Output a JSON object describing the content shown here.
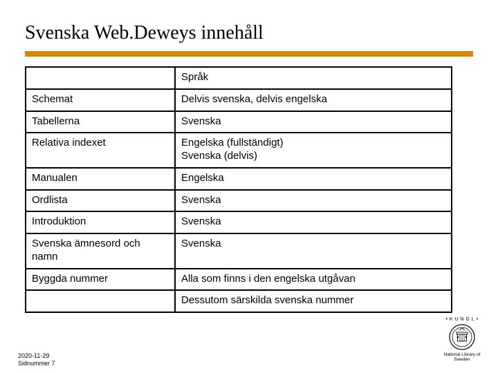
{
  "title": "Svenska Web.Deweys innehåll",
  "table": {
    "header": {
      "col1": "",
      "col2": "Språk"
    },
    "rows": [
      {
        "col1": "Schemat",
        "col2": "Delvis svenska, delvis engelska"
      },
      {
        "col1": "Tabellerna",
        "col2": "Svenska"
      },
      {
        "col1": "Relativa indexet",
        "col2": "Engelska (fullständigt)\nSvenska (delvis)"
      },
      {
        "col1": "Manualen",
        "col2": "Engelska"
      },
      {
        "col1": "Ordlista",
        "col2": "Svenska"
      },
      {
        "col1": "Introduktion",
        "col2": "Svenska"
      },
      {
        "col1": "Svenska ämnesord och namn",
        "col2": "Svenska"
      },
      {
        "col1": "Byggda nummer",
        "col2": "Alla som finns i den engelska utgåvan"
      },
      {
        "col1": "",
        "col2": "Dessutom särskilda svenska nummer"
      }
    ]
  },
  "footer": {
    "date": "2020-11-29",
    "page": "Sidnummer 7"
  },
  "logo": {
    "top_text": "• K U N G L •",
    "bottom_text": "National Library of Sweden"
  }
}
